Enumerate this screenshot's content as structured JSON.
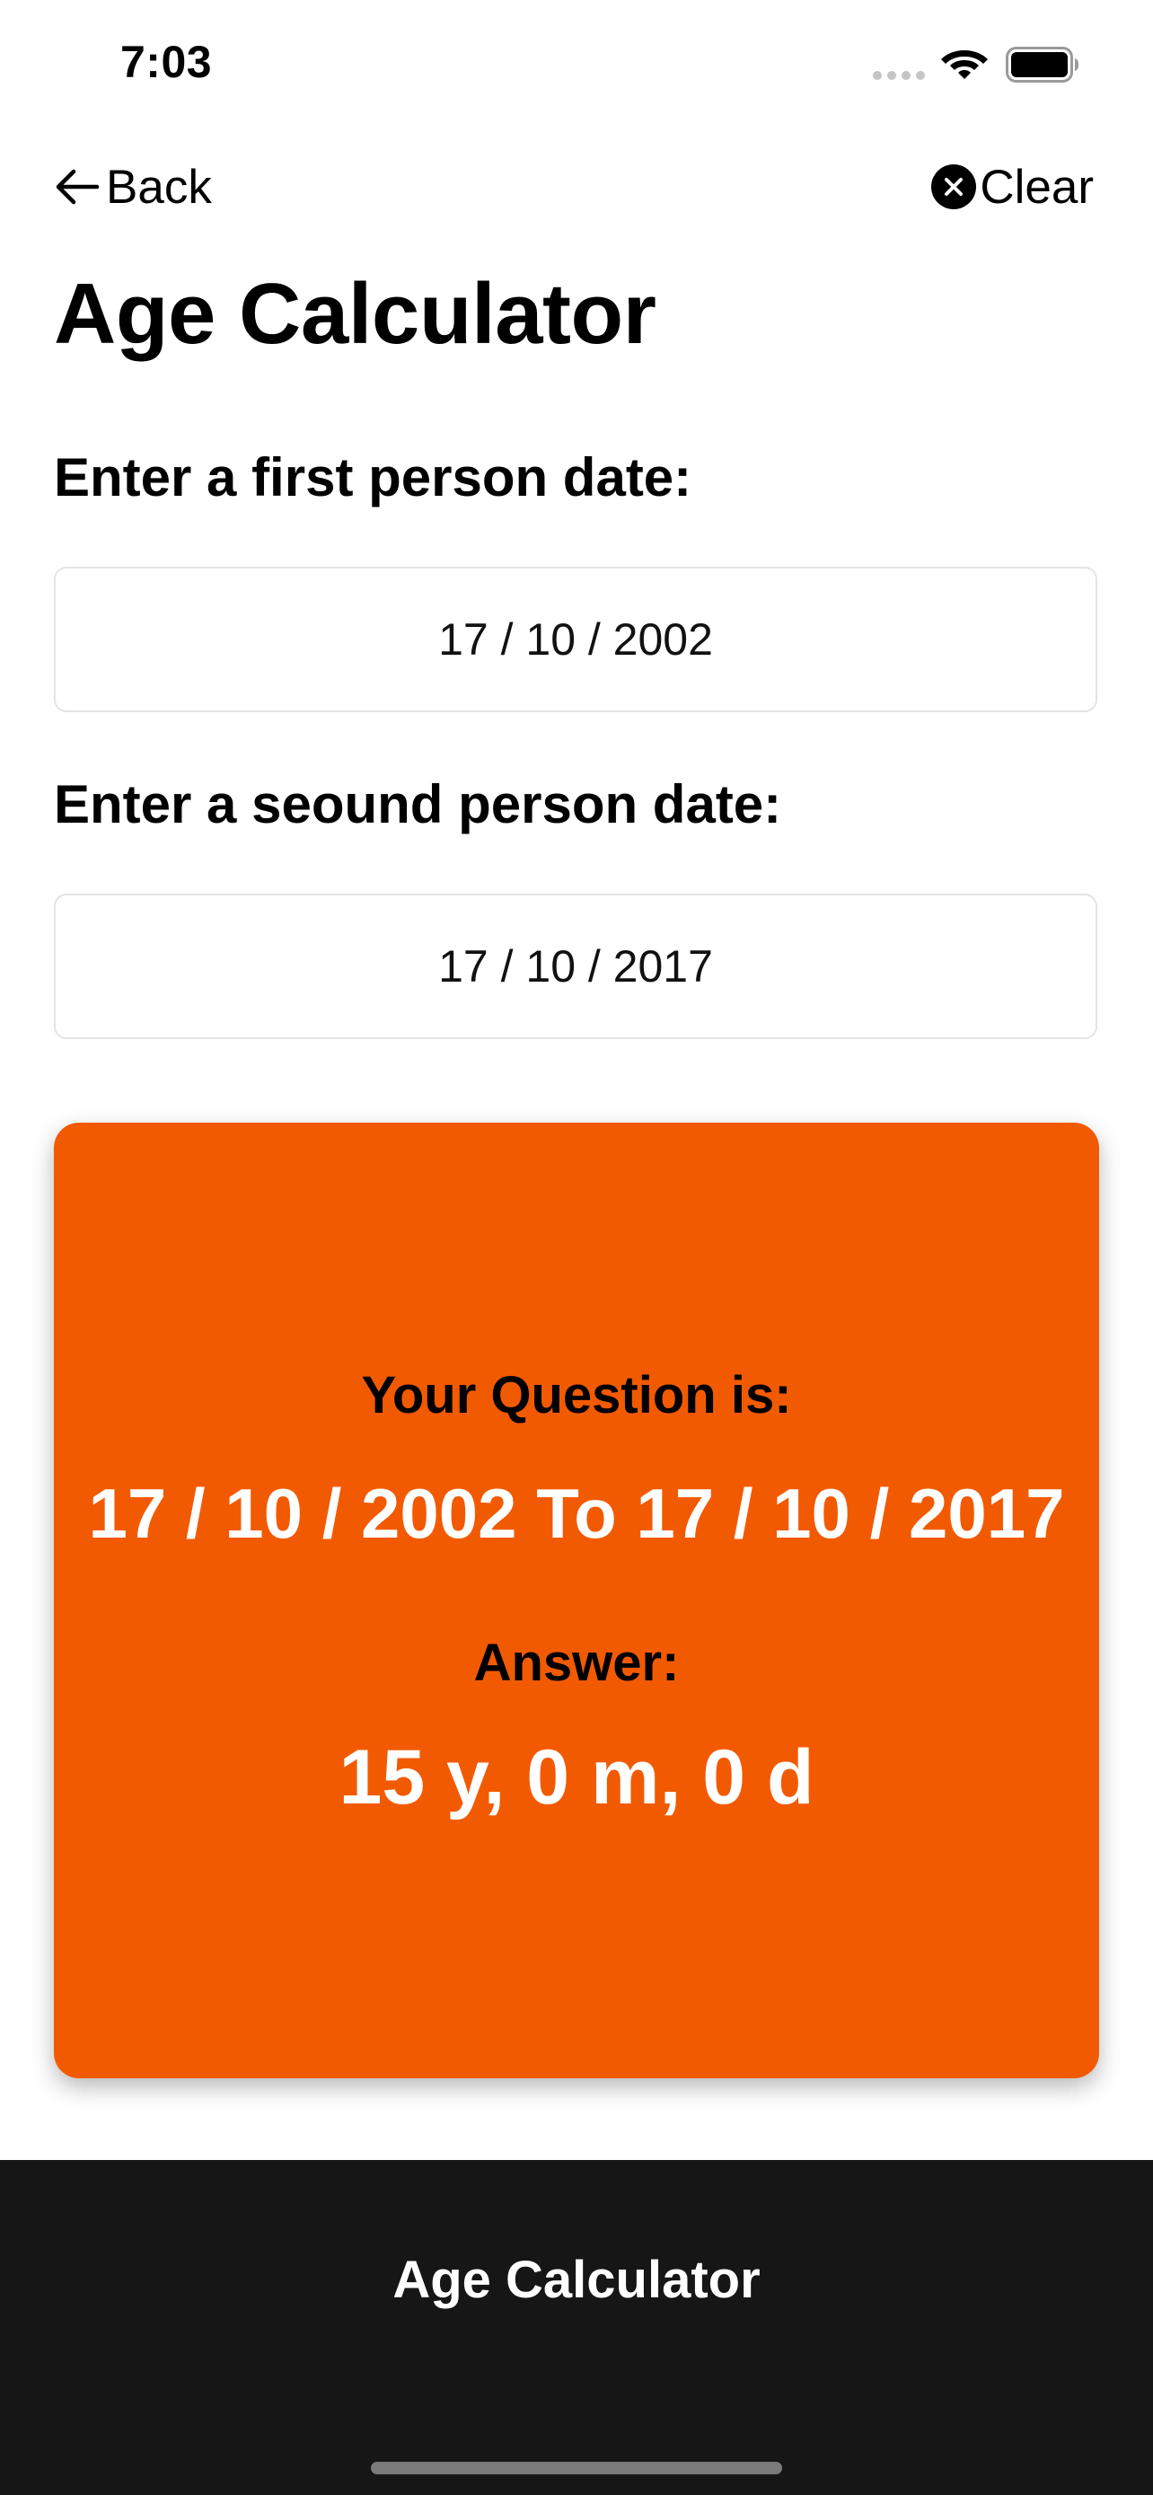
{
  "status_bar": {
    "time": "7:03",
    "icons": [
      "signal-dots-icon",
      "wifi-icon",
      "battery-icon"
    ]
  },
  "nav": {
    "back_label": "Back",
    "clear_label": "Clear",
    "back_icon": "arrow-left-icon",
    "clear_icon": "close-circle-icon"
  },
  "page_title": "Age Calculator",
  "first_date": {
    "label": "Enter a first person date:",
    "value": "17 / 10 / 2002"
  },
  "second_date": {
    "label": "Enter a seound person date:",
    "value": "17 / 10 / 2017"
  },
  "result": {
    "question_label": "Your Question is:",
    "question_value": "17 / 10 / 2002 To 17 / 10 / 2017",
    "answer_label": "Answer:",
    "answer_value": "15 y, 0 m, 0 d"
  },
  "bottom_bar": {
    "title": "Age Calculator"
  },
  "colors": {
    "accent": "#f25a02",
    "bottom_bar": "#161616"
  }
}
